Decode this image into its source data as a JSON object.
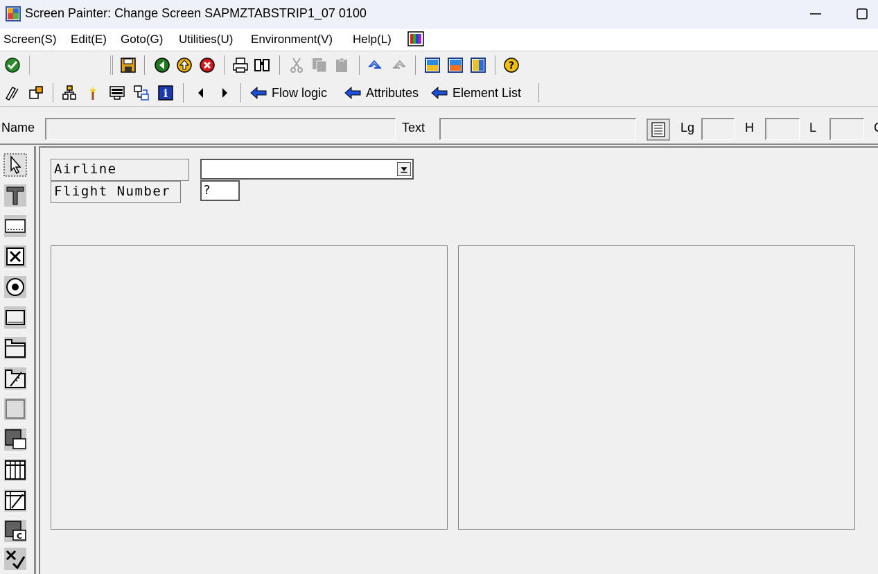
{
  "window": {
    "title": "Screen Painter:  Change Screen SAPMZTABSTRIP1_07 0100"
  },
  "menu": {
    "items": [
      "Screen(S)",
      "Edit(E)",
      "Goto(G)",
      "Utilities(U)",
      "Environment(V)",
      "Help(L)"
    ]
  },
  "toolbar2": {
    "flow_logic": "Flow logic",
    "attributes": "Attributes",
    "element_list": "Element List"
  },
  "attributes_row": {
    "name_label": "Name",
    "name_value": "",
    "text_label": "Text",
    "text_value": "",
    "lg_label": "Lg",
    "lg_value": "",
    "h_label": "H",
    "h_value": "",
    "l_label": "L",
    "l_value": "",
    "c_label": "C"
  },
  "screen": {
    "airline_label": "Airline",
    "airline_value": "",
    "flight_number_label": "Flight Number",
    "flight_number_value": "?"
  },
  "colors": {
    "ok_green": "#2a8a2a",
    "back_green": "#1d7a1d",
    "exit_yellow": "#f0b400",
    "cancel_red": "#d01818",
    "arrow_blue": "#1a4fd6",
    "save_orange": "#e0a020"
  },
  "icons": {
    "toolbar1": [
      "enter-icon",
      "save-icon",
      "back-icon",
      "exit-icon",
      "cancel-icon",
      "print-icon",
      "find-icon",
      "cut-icon",
      "copy-icon",
      "paste-icon",
      "undo-icon",
      "redo-icon",
      "layout-icon-1",
      "layout-icon-2",
      "layout-icon-3",
      "help-icon"
    ],
    "toolbar2": [
      "edit-icon",
      "hierarchy-icon",
      "org-icon",
      "magic-icon",
      "screen-element-icon",
      "transfer-icon",
      "info-icon",
      "previous-icon",
      "next-icon"
    ],
    "palette": [
      "pointer-tool",
      "text-field-tool",
      "input-field-tool",
      "checkbox-tool",
      "radio-button-tool",
      "pushbutton-tool",
      "tabstrip-tool",
      "tabstrip-wizard-tool",
      "box-tool",
      "subscreen-tool",
      "table-control-tool",
      "table-wizard-tool",
      "custom-control-tool",
      "status-icon-tool"
    ]
  }
}
